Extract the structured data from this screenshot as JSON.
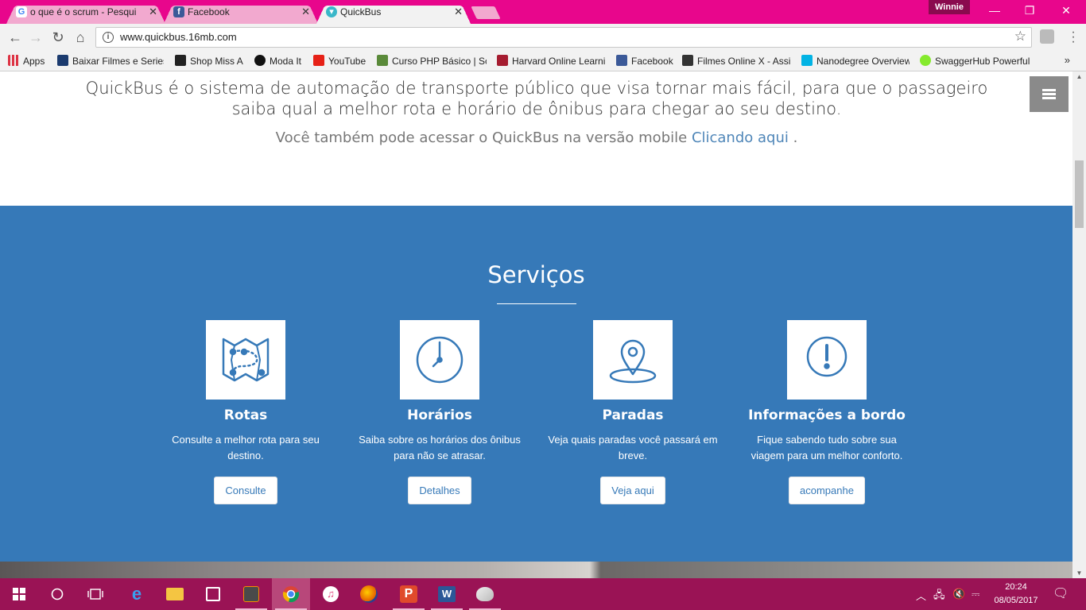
{
  "browser": {
    "tabs": [
      {
        "title": "o que é o scrum - Pesqui",
        "favicon": "google-icon",
        "active": false
      },
      {
        "title": "Facebook",
        "favicon": "facebook-icon",
        "active": false
      },
      {
        "title": "QuickBus",
        "favicon": "quickbus-icon",
        "active": true
      }
    ],
    "profile_name": "Winnie",
    "url": "www.quickbus.16mb.com",
    "bookmarks": [
      {
        "label": "Apps",
        "icon": "apps-grid-icon"
      },
      {
        "label": "Baixar Filmes e Series",
        "icon": "film-icon"
      },
      {
        "label": "Shop Miss A",
        "icon": "shop-icon"
      },
      {
        "label": "Moda It",
        "icon": "moda-it-icon"
      },
      {
        "label": "YouTube",
        "icon": "youtube-icon"
      },
      {
        "label": "Curso PHP Básico | Sc",
        "icon": "php-icon"
      },
      {
        "label": "Harvard Online Learni",
        "icon": "harvard-icon"
      },
      {
        "label": "Facebook",
        "icon": "facebook-icon"
      },
      {
        "label": "Filmes Online X - Assi",
        "icon": "x-icon"
      },
      {
        "label": "Nanodegree Overview",
        "icon": "udacity-icon"
      },
      {
        "label": "SwaggerHub Powerful",
        "icon": "swagger-icon"
      }
    ],
    "bookmarks_more": "»"
  },
  "page": {
    "intro_text": "QuickBus é o sistema de automação de transporte público que visa tornar mais fácil, para que o passageiro saiba qual a melhor rota e horário de ônibus para chegar ao seu destino.",
    "mobile_prefix": "Você também pode acessar o QuickBus na versão mobile",
    "mobile_link": "Clicando aqui",
    "mobile_suffix": ".",
    "services_title": "Serviços",
    "services": [
      {
        "icon": "map-route-icon",
        "title": "Rotas",
        "text": "Consulte a melhor rota para seu destino.",
        "button": "Consulte"
      },
      {
        "icon": "clock-icon",
        "title": "Horários",
        "text": "Saiba sobre os horários dos ônibus para não se atrasar.",
        "button": "Detalhes"
      },
      {
        "icon": "map-pin-icon",
        "title": "Paradas",
        "text": "Veja quais paradas você passará em breve.",
        "button": "Veja aqui"
      },
      {
        "icon": "exclamation-icon",
        "title": "Informações a bordo",
        "text": "Fique sabendo tudo sobre sua viagem para um melhor conforto.",
        "button": "acompanhe"
      }
    ]
  },
  "taskbar": {
    "time": "20:24",
    "date": "08/05/2017"
  },
  "colors": {
    "accent_pink": "#e8068c",
    "services_blue": "#3679b8",
    "taskbar": "#9a1355"
  }
}
